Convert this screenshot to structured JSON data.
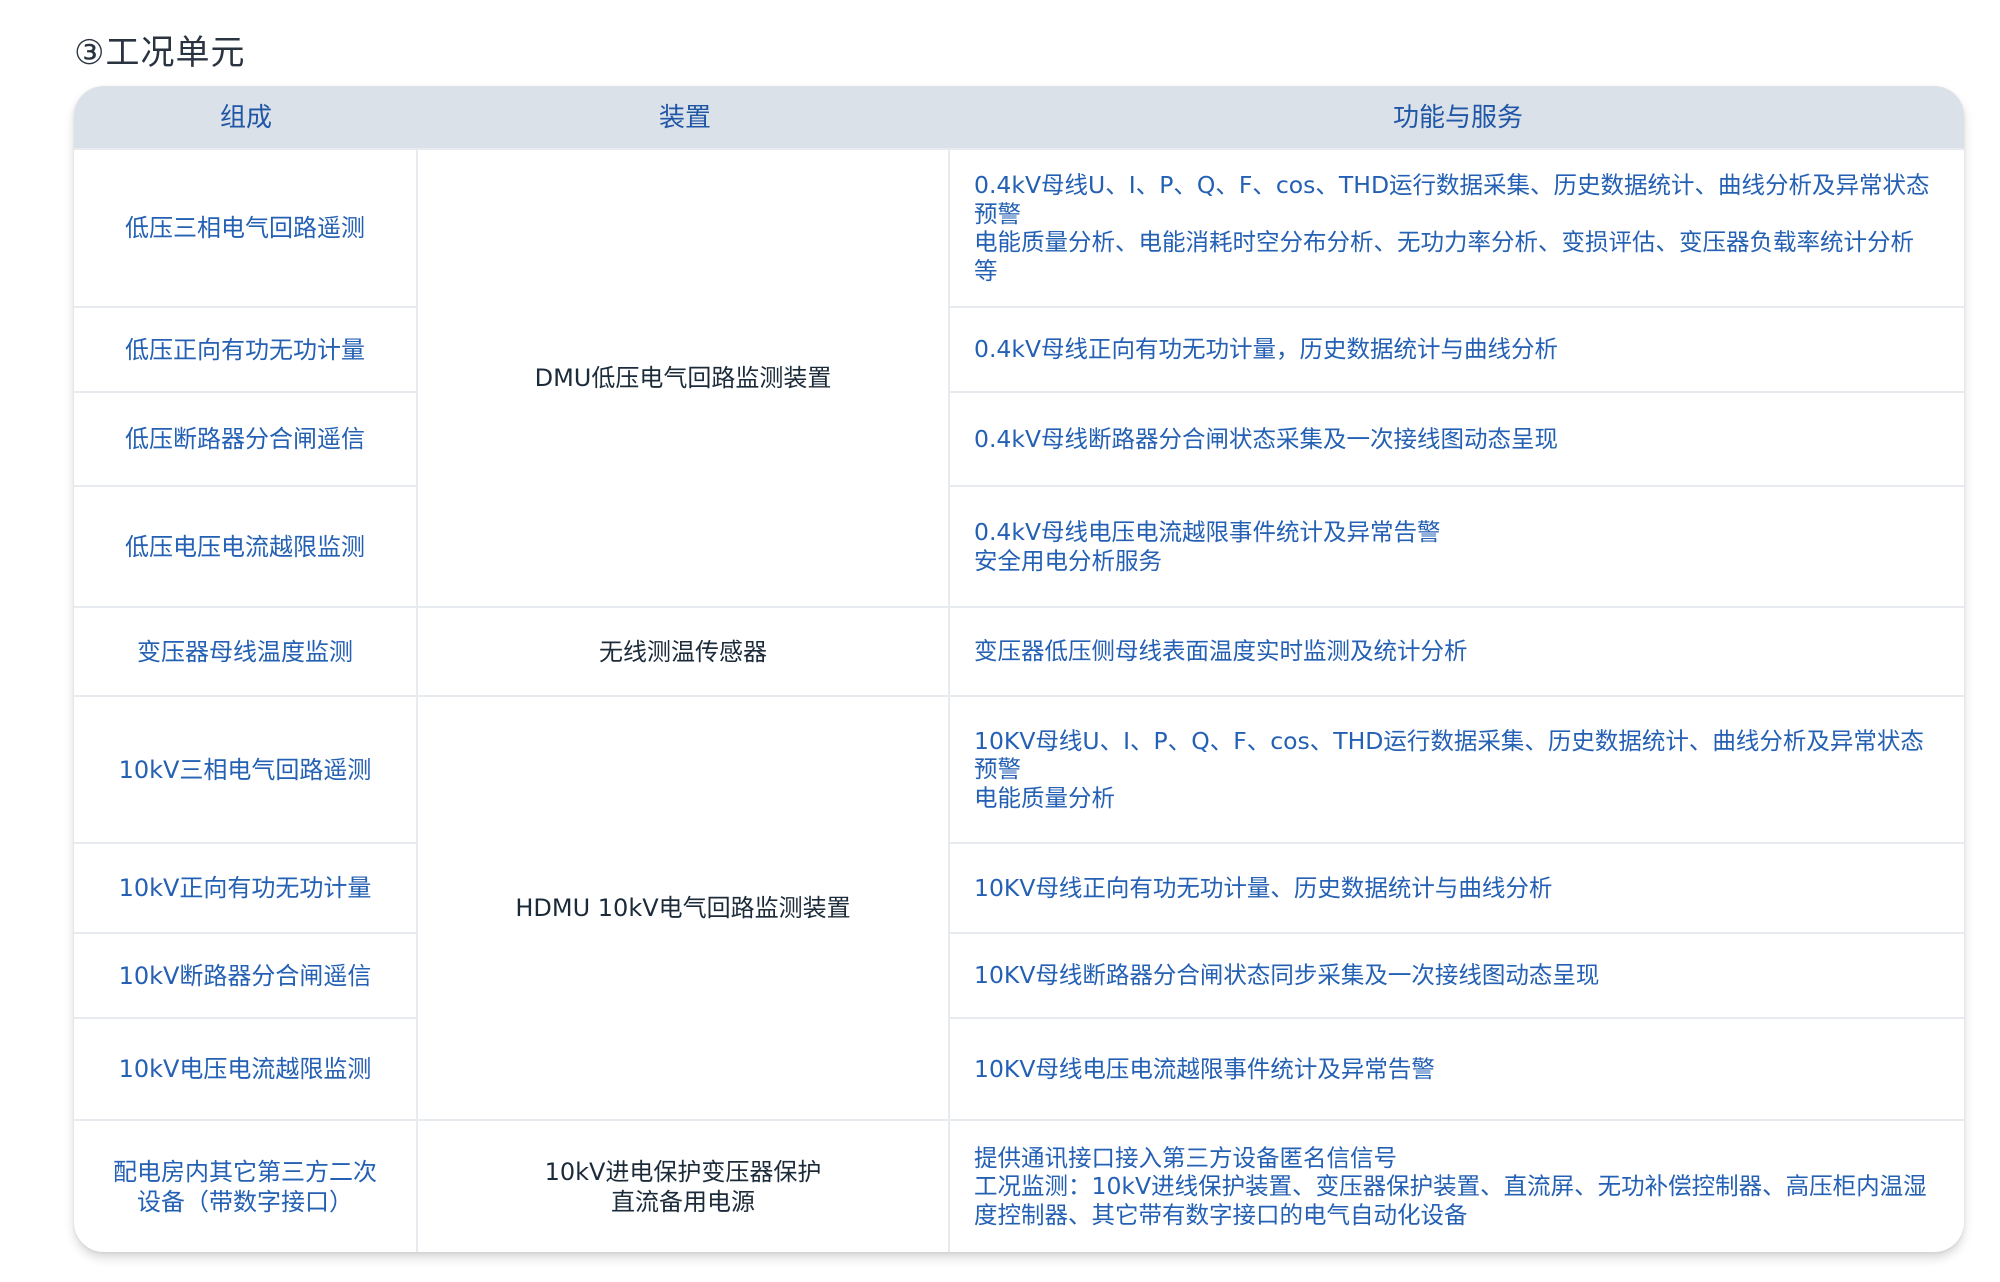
{
  "section": {
    "title": "③工况单元"
  },
  "table": {
    "headers": {
      "component": "组成",
      "device": "装置",
      "function": "功能与服务"
    },
    "components": [
      "低压三相电气回路遥测",
      "低压正向有功无功计量",
      "低压断路器分合闸遥信",
      "低压电压电流越限监测",
      "变压器母线温度监测",
      "10kV三相电气回路遥测",
      "10kV正向有功无功计量",
      "10kV断路器分合闸遥信",
      "10kV电压电流越限监测",
      "配电房内其它第三方二次设备（带数字接口）"
    ],
    "devices": [
      {
        "lines": [
          "DMU低压电气回路监测装置"
        ]
      },
      {
        "lines": [
          "无线测温传感器"
        ]
      },
      {
        "lines": [
          "HDMU 10kV电气回路监测装置"
        ]
      },
      {
        "lines": [
          "10kV进电保护变压器保护",
          "直流备用电源"
        ]
      }
    ],
    "functions": [
      {
        "lines": [
          "0.4kV母线U、I、P、Q、F、cos、THD运行数据采集、历史数据统计、曲线分析及异常状态预警",
          "电能质量分析、电能消耗时空分布分析、无功力率分析、变损评估、变压器负载率统计分析等"
        ]
      },
      {
        "lines": [
          "0.4kV母线正向有功无功计量，历史数据统计与曲线分析"
        ]
      },
      {
        "lines": [
          "0.4kV母线断路器分合闸状态采集及一次接线图动态呈现"
        ]
      },
      {
        "lines": [
          "0.4kV母线电压电流越限事件统计及异常告警",
          "安全用电分析服务"
        ]
      },
      {
        "lines": [
          "变压器低压侧母线表面温度实时监测及统计分析"
        ]
      },
      {
        "lines": [
          "10KV母线U、I、P、Q、F、cos、THD运行数据采集、历史数据统计、曲线分析及异常状态预警",
          "电能质量分析"
        ]
      },
      {
        "lines": [
          "10KV母线正向有功无功计量、历史数据统计与曲线分析"
        ]
      },
      {
        "lines": [
          "10KV母线断路器分合闸状态同步采集及一次接线图动态呈现"
        ]
      },
      {
        "lines": [
          "10KV母线电压电流越限事件统计及异常告警"
        ]
      },
      {
        "lines": [
          "提供通讯接口接入第三方设备匿名信信号",
          "工况监测：10kV进线保护装置、变压器保护装置、直流屏、无功补偿控制器、高压柜内温湿度控制器、其它带有数字接口的电气自动化设备"
        ]
      }
    ]
  }
}
